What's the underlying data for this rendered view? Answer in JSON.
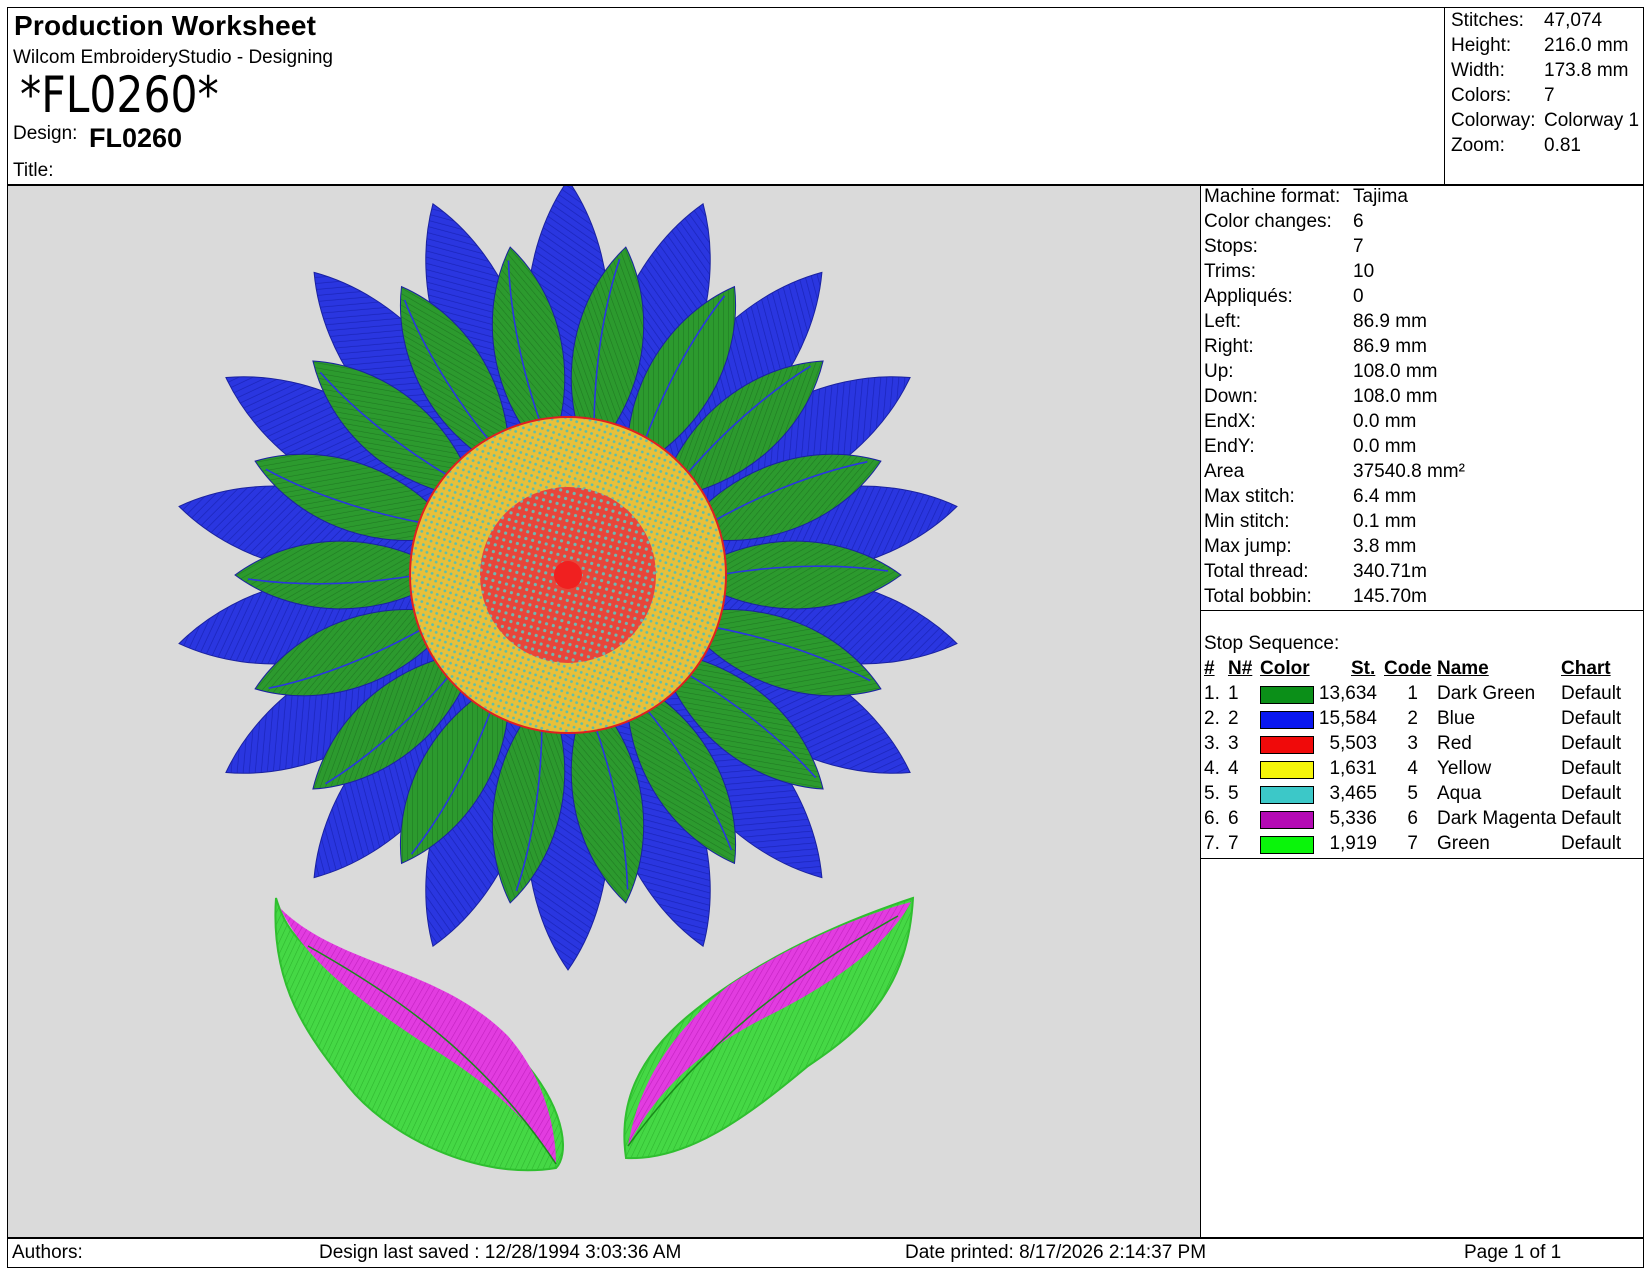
{
  "header": {
    "title": "Production Worksheet",
    "software": "Wilcom EmbroideryStudio - Designing",
    "design_code_big": "*FL0260*",
    "design_label": "Design:",
    "design_value": "FL0260",
    "title_label": "Title:"
  },
  "stats": [
    {
      "label": "Stitches:",
      "value": "47,074"
    },
    {
      "label": "Height:",
      "value": "216.0 mm"
    },
    {
      "label": "Width:",
      "value": "173.8 mm"
    },
    {
      "label": "Colors:",
      "value": "7"
    },
    {
      "label": "Colorway:",
      "value": "Colorway 1"
    },
    {
      "label": "Zoom:",
      "value": "0.81"
    }
  ],
  "machine_info": [
    {
      "label": "Machine format:",
      "value": "Tajima"
    },
    {
      "label": "Color changes:",
      "value": "6"
    },
    {
      "label": "Stops:",
      "value": "7"
    },
    {
      "label": "Trims:",
      "value": "10"
    },
    {
      "label": "Appliqués:",
      "value": "0"
    },
    {
      "label": "Left:",
      "value": "86.9 mm"
    },
    {
      "label": "Right:",
      "value": "86.9 mm"
    },
    {
      "label": "Up:",
      "value": "108.0 mm"
    },
    {
      "label": "Down:",
      "value": "108.0 mm"
    },
    {
      "label": "EndX:",
      "value": "0.0 mm"
    },
    {
      "label": "EndY:",
      "value": "0.0 mm"
    },
    {
      "label": "Area",
      "value": "37540.8 mm²"
    },
    {
      "label": "Max stitch:",
      "value": "6.4 mm"
    },
    {
      "label": "Min stitch:",
      "value": "0.1 mm"
    },
    {
      "label": "Max jump:",
      "value": "3.8 mm"
    },
    {
      "label": "Total thread:",
      "value": "340.71m"
    },
    {
      "label": "Total bobbin:",
      "value": "145.70m"
    }
  ],
  "stop_sequence": {
    "title": "Stop Sequence:",
    "headers": {
      "num": "#",
      "n": "N#",
      "color": "Color",
      "st": "St.",
      "code": "Code",
      "name": "Name",
      "chart": "Chart"
    },
    "rows": [
      {
        "num": "1.",
        "n": "1",
        "color": "#0b8f18",
        "st": "13,634",
        "code": "1",
        "name": "Dark Green",
        "chart": "Default"
      },
      {
        "num": "2.",
        "n": "2",
        "color": "#0a18f0",
        "st": "15,584",
        "code": "2",
        "name": "Blue",
        "chart": "Default"
      },
      {
        "num": "3.",
        "n": "3",
        "color": "#f00a0a",
        "st": "5,503",
        "code": "3",
        "name": "Red",
        "chart": "Default"
      },
      {
        "num": "4.",
        "n": "4",
        "color": "#f5f50a",
        "st": "1,631",
        "code": "4",
        "name": "Yellow",
        "chart": "Default"
      },
      {
        "num": "5.",
        "n": "5",
        "color": "#3cc8c8",
        "st": "3,465",
        "code": "5",
        "name": "Aqua",
        "chart": "Default"
      },
      {
        "num": "6.",
        "n": "6",
        "color": "#b40ab4",
        "st": "5,336",
        "code": "6",
        "name": "Dark Magenta",
        "chart": "Default"
      },
      {
        "num": "7.",
        "n": "7",
        "color": "#0af50a",
        "st": "1,919",
        "code": "7",
        "name": "Green",
        "chart": "Default"
      }
    ]
  },
  "footer": {
    "authors": "Authors:",
    "last_saved": "Design last saved : 12/28/1994 3:03:36 AM",
    "printed": "Date printed: 8/17/2026 2:14:37 PM",
    "page": "Page 1 of 1"
  },
  "artwork": {
    "petal_blue": "#2a36e0",
    "petal_green": "#2c9a2e",
    "center_yellow": "#e8c03a",
    "center_red": "#e8453a",
    "leaf_magenta": "#e23ce0",
    "leaf_green": "#45d845"
  }
}
